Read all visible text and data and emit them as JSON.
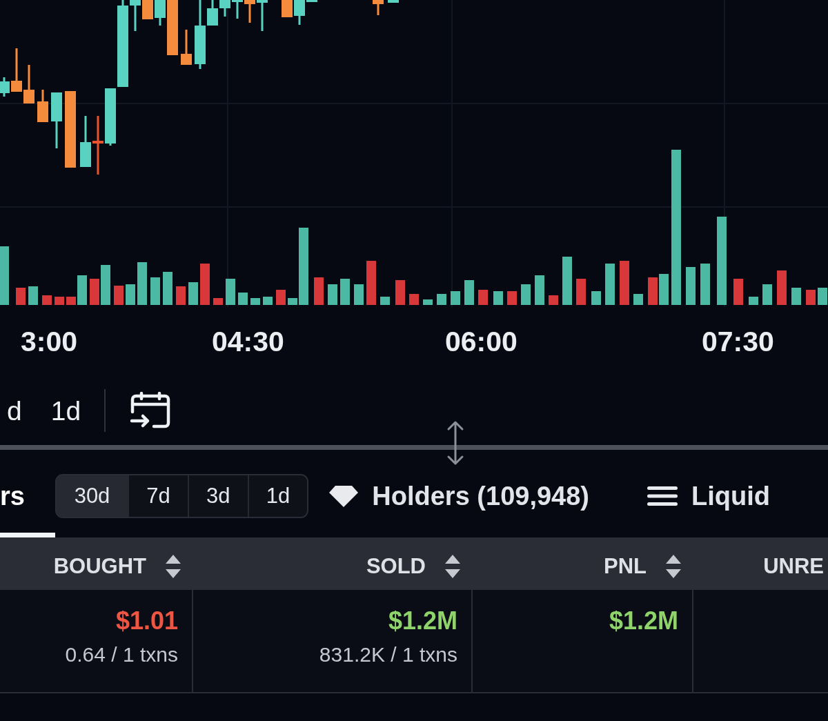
{
  "chart": {
    "time_labels": [
      "3:00",
      "04:30",
      "06:00",
      "07:30"
    ]
  },
  "toolbar": {
    "intervals": [
      {
        "label": "d",
        "selected": false
      },
      {
        "label": "1d",
        "selected": false
      }
    ]
  },
  "tab_bar": {
    "items": [
      {
        "kind": "tab",
        "label": "rs",
        "selected": true
      },
      {
        "kind": "period_filter",
        "options": [
          {
            "label": "30d",
            "selected": true
          },
          {
            "label": "7d",
            "selected": false
          },
          {
            "label": "3d",
            "selected": false
          },
          {
            "label": "1d",
            "selected": false
          }
        ]
      },
      {
        "kind": "tab",
        "label": "Holders (109,948)",
        "selected": false
      },
      {
        "kind": "tab",
        "label": "Liquid",
        "selected": false
      }
    ]
  },
  "table": {
    "columns": [
      {
        "label": "BOUGHT",
        "sortable": true
      },
      {
        "label": "SOLD",
        "sortable": true
      },
      {
        "label": "PNL",
        "sortable": true
      },
      {
        "label": "UNRE",
        "sortable": false
      }
    ],
    "rows": [
      {
        "cells": [
          {
            "value": "$1.01",
            "color": "#ef5543",
            "detail": "0.64 / 1 txns"
          },
          {
            "value": "$1.2M",
            "color": "#8fd46b",
            "detail": "831.2K / 1 txns"
          },
          {
            "value": "$1.2M",
            "color": "#8fd46b"
          }
        ]
      }
    ]
  }
}
